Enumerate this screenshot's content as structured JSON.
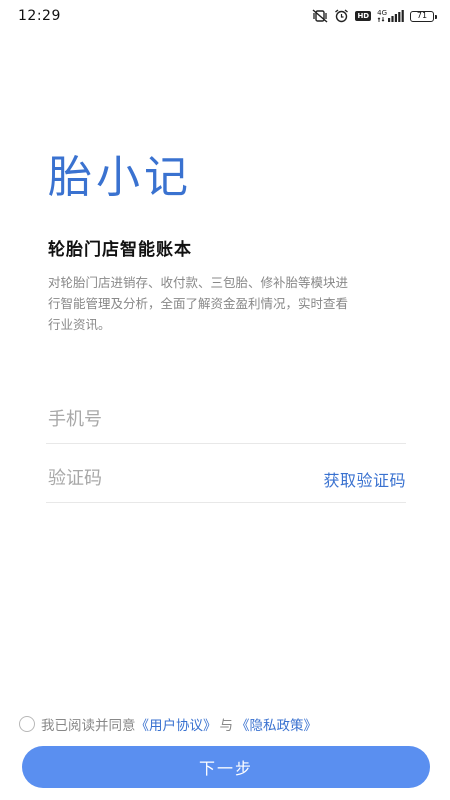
{
  "status_bar": {
    "time": "12:29",
    "icons": [
      "mute-vibrate-icon",
      "alarm-icon",
      "hd-icon",
      "4g-signal-icon",
      "battery-icon"
    ],
    "hd_label": "HD",
    "network_label": "4G",
    "battery_level": "71"
  },
  "app": {
    "title": "胎小记",
    "subtitle": "轮胎门店智能账本",
    "description": "对轮胎门店进销存、收付款、三包胎、修补胎等模块进行智能管理及分析，全面了解资金盈利情况，实时查看行业资讯。"
  },
  "form": {
    "phone_placeholder": "手机号",
    "phone_value": "",
    "code_placeholder": "验证码",
    "code_value": "",
    "get_code_label": "获取验证码"
  },
  "agreement": {
    "prefix": "我已阅读并同意",
    "user_agreement": "《用户协议》",
    "and": "与",
    "privacy_policy": "《隐私政策》",
    "checked": false
  },
  "actions": {
    "next_label": "下一步"
  },
  "colors": {
    "accent": "#3a72d0",
    "button": "#5a8ff0",
    "placeholder": "#a8a8a8",
    "description": "#888888"
  }
}
